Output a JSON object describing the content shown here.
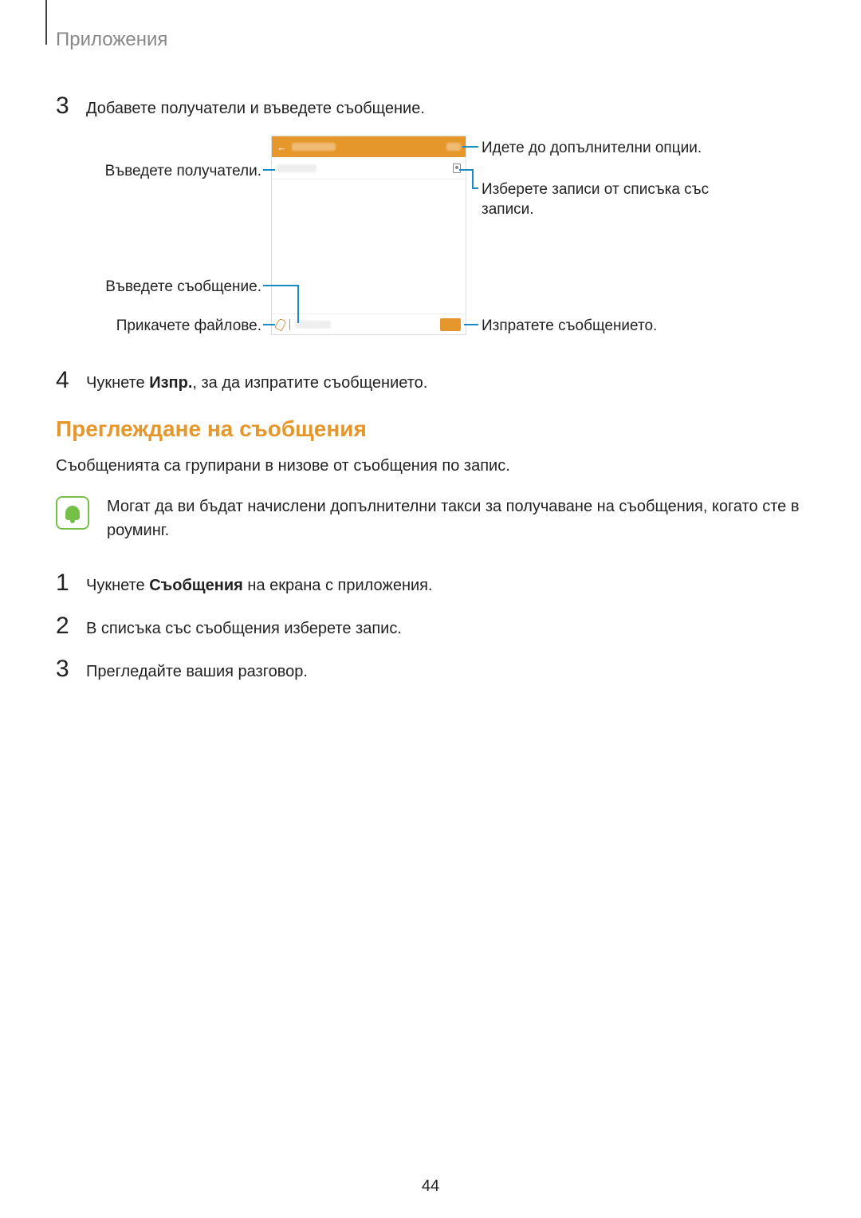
{
  "header": "Приложения",
  "step3_num": "3",
  "step3_text": "Добавете получатели и въведете съобщение.",
  "callouts": {
    "enter_recipients": "Въведете получатели.",
    "enter_message": "Въведете съобщение.",
    "attach_files": "Прикачете файлове.",
    "more_options": "Идете до допълнителни опции.",
    "select_contacts_l1": "Изберете записи от списъка със",
    "select_contacts_l2": "записи.",
    "send_message": "Изпратете съобщението."
  },
  "step4_num": "4",
  "step4_text_prefix": "Чукнете ",
  "step4_bold": "Изпр.",
  "step4_text_suffix": ", за да изпратите съобщението.",
  "section_title": "Преглеждане на съобщения",
  "section_para": "Съобщенията са групирани в низове от съобщения по запис.",
  "note_text": "Могат да ви бъдат начислени допълнителни такси за получаване на съобщения, когато сте в роуминг.",
  "v_step1_num": "1",
  "v_step1_prefix": "Чукнете ",
  "v_step1_bold": "Съобщения",
  "v_step1_suffix": " на екрана с приложения.",
  "v_step2_num": "2",
  "v_step2_text": "В списъка със съобщения изберете запис.",
  "v_step3_num": "3",
  "v_step3_text": "Прегледайте вашия разговор.",
  "page_number": "44"
}
